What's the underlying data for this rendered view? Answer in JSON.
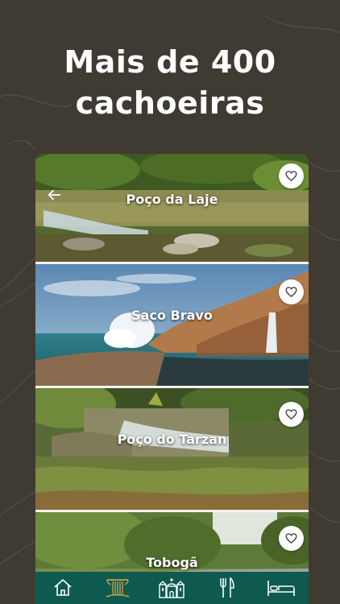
{
  "headline": {
    "line1": "Mais de 400",
    "line2": "cachoeiras"
  },
  "cards": [
    {
      "title": "Poço da Laje",
      "favorite_icon": "heart-outline-icon"
    },
    {
      "title": "Saco Bravo",
      "favorite_icon": "heart-outline-icon"
    },
    {
      "title": "Poço do Tarzan",
      "favorite_icon": "heart-outline-icon"
    },
    {
      "title": "Tobogã",
      "favorite_icon": "heart-outline-icon"
    }
  ],
  "tabbar": {
    "items": [
      {
        "icon": "home-icon",
        "active": false
      },
      {
        "icon": "waterfall-icon",
        "active": true
      },
      {
        "icon": "church-icon",
        "active": false
      },
      {
        "icon": "fork-knife-icon",
        "active": false
      },
      {
        "icon": "bed-icon",
        "active": false
      }
    ],
    "active_color": "#c9a24a"
  },
  "colors": {
    "background": "#3f3b33",
    "tabbar": "#0e5a4f",
    "accent": "#c9a24a"
  }
}
